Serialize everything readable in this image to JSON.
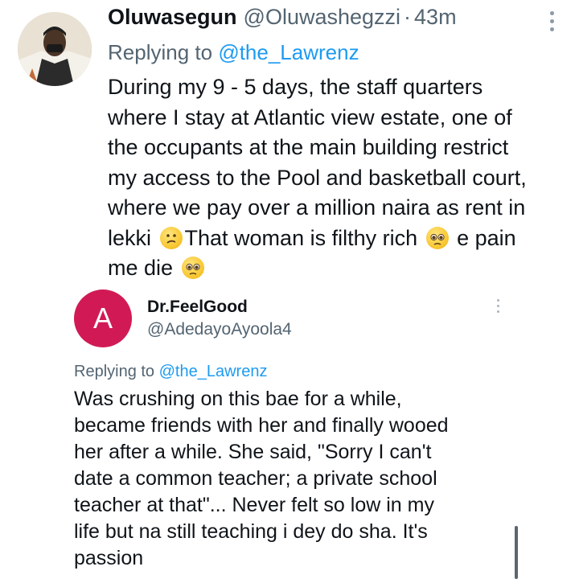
{
  "tweet1": {
    "author_name": "Oluwasegun",
    "author_handle": "@Oluwashegzzi",
    "separator": "·",
    "timestamp": "43m",
    "replying_prefix": "Replying to ",
    "replying_mention": "@the_Lawrenz",
    "body_lines": [
      "During my 9 - 5 days, the staff quarters",
      "where I stay at Atlantic view estate, one of",
      "the occupants at the main building restrict",
      "my access to the Pool and basketball court,",
      "where we pay over a million naira as rent in"
    ],
    "body_line6_a": "lekki ",
    "body_line6_b": "That woman is filthy rich ",
    "body_line6_c": " e pain",
    "body_line7": "me die ",
    "emojis": [
      "confused-face-emoji",
      "pleading-face-emoji",
      "pleading-face-emoji"
    ]
  },
  "tweet2": {
    "avatar_letter": "A",
    "avatar_color": "#d11a55",
    "author_name": "Dr.FeelGood",
    "author_handle": "@AdedayoAyoola4",
    "replying_prefix": "Replying to ",
    "replying_mention": "@the_Lawrenz",
    "body_lines": [
      "Was crushing on this bae for a while,",
      "became friends with her and finally wooed",
      "her after a while. She said, \"Sorry I can't",
      "date a common teacher; a private school",
      "teacher at that\"... Never felt so low in my",
      "life but na still teaching i dey do sha. It's",
      "passion"
    ]
  },
  "colors": {
    "text": "#0f1419",
    "secondary": "#536471",
    "link": "#1d9bf0"
  }
}
